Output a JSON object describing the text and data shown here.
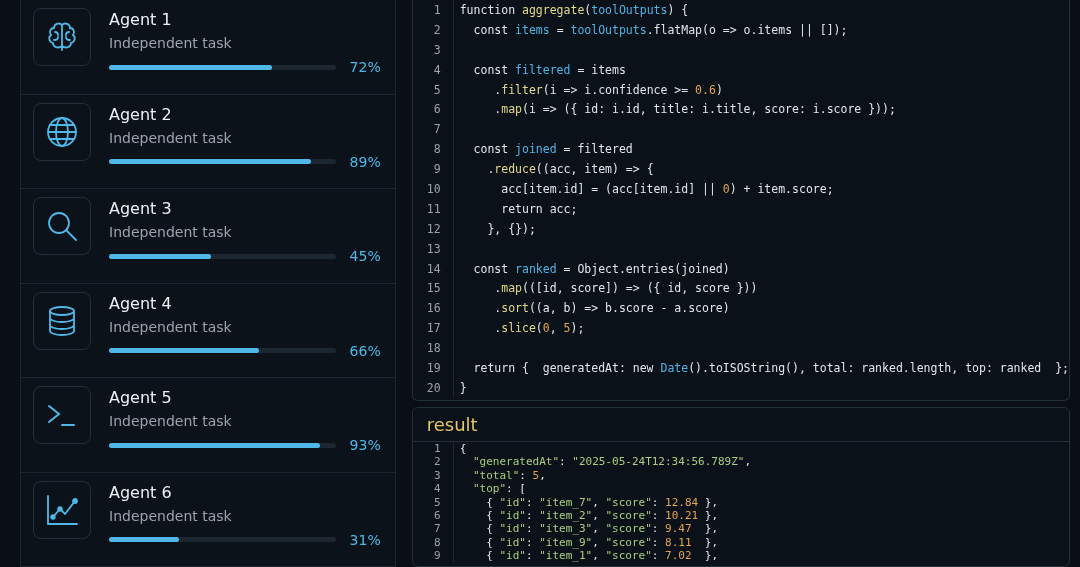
{
  "agents": [
    {
      "name": "Agent 1",
      "task": "Independent task",
      "level": 0.72,
      "percent": "72%"
    },
    {
      "name": "Agent 2",
      "task": "Independent task",
      "level": 0.89,
      "percent": "89%"
    },
    {
      "name": "Agent 3",
      "task": "Independent task",
      "level": 0.45,
      "percent": "45%"
    },
    {
      "name": "Agent 4",
      "task": "Independent task",
      "level": 0.66,
      "percent": "66%"
    },
    {
      "name": "Agent 5",
      "task": "Independent task",
      "level": 0.93,
      "percent": "93%"
    },
    {
      "name": "Agent 6",
      "task": "Independent task",
      "level": 0.31,
      "percent": "31%"
    }
  ],
  "code": {
    "lines": [
      {
        "number": "1",
        "tokens": [
          {
            "text": "function ",
            "kind": "plain"
          },
          {
            "text": "aggregate",
            "kind": "fn"
          },
          {
            "text": "(",
            "kind": "plain"
          },
          {
            "text": "toolOutputs",
            "kind": "var"
          },
          {
            "text": ") {",
            "kind": "plain"
          }
        ]
      },
      {
        "number": "2",
        "tokens": [
          {
            "text": "  const ",
            "kind": "plain"
          },
          {
            "text": "items",
            "kind": "var"
          },
          {
            "text": " = ",
            "kind": "plain"
          },
          {
            "text": "toolOutputs",
            "kind": "var"
          },
          {
            "text": ".flatMap(o => o.items || []);",
            "kind": "plain"
          }
        ]
      },
      {
        "number": "3"
      },
      {
        "number": "4",
        "tokens": [
          {
            "text": "  const ",
            "kind": "plain"
          },
          {
            "text": "filtered",
            "kind": "var"
          },
          {
            "text": " = items",
            "kind": "plain"
          }
        ]
      },
      {
        "number": "5",
        "tokens": [
          {
            "text": "     .",
            "kind": "plain"
          },
          {
            "text": "filter",
            "kind": "fn"
          },
          {
            "text": "(i => i.confidence >= ",
            "kind": "plain"
          },
          {
            "text": "0.6",
            "kind": "num"
          },
          {
            "text": ")",
            "kind": "plain"
          }
        ]
      },
      {
        "number": "6",
        "tokens": [
          {
            "text": "     .",
            "kind": "plain"
          },
          {
            "text": "map",
            "kind": "fn"
          },
          {
            "text": "(i => ({ id: i.id, title: i.title, score: i.score }));",
            "kind": "plain"
          }
        ]
      },
      {
        "number": "7"
      },
      {
        "number": "8",
        "tokens": [
          {
            "text": "  const ",
            "kind": "plain"
          },
          {
            "text": "joined",
            "kind": "var"
          },
          {
            "text": " = filtered",
            "kind": "plain"
          }
        ]
      },
      {
        "number": "9",
        "tokens": [
          {
            "text": "    .",
            "kind": "plain"
          },
          {
            "text": "reduce",
            "kind": "fn"
          },
          {
            "text": "((acc, item) => {",
            "kind": "plain"
          }
        ]
      },
      {
        "number": "10",
        "tokens": [
          {
            "text": "      acc[item.id] = (acc[item.id] || ",
            "kind": "plain"
          },
          {
            "text": "0",
            "kind": "num"
          },
          {
            "text": ") + item.score;",
            "kind": "plain"
          }
        ]
      },
      {
        "number": "11",
        "tokens": [
          {
            "text": "      return acc;",
            "kind": "plain"
          }
        ]
      },
      {
        "number": "12",
        "tokens": [
          {
            "text": "    }, {});",
            "kind": "plain"
          }
        ]
      },
      {
        "number": "13"
      },
      {
        "number": "14",
        "tokens": [
          {
            "text": "  const ",
            "kind": "plain"
          },
          {
            "text": "ranked",
            "kind": "var"
          },
          {
            "text": " = Object.entries(joined)",
            "kind": "plain"
          }
        ]
      },
      {
        "number": "15",
        "tokens": [
          {
            "text": "     .",
            "kind": "plain"
          },
          {
            "text": "map",
            "kind": "fn"
          },
          {
            "text": "(([id, score]) => ({ id, score }))",
            "kind": "plain"
          }
        ]
      },
      {
        "number": "16",
        "tokens": [
          {
            "text": "     .",
            "kind": "plain"
          },
          {
            "text": "sort",
            "kind": "fn"
          },
          {
            "text": "((a, b) => b.score - a.score)",
            "kind": "plain"
          }
        ]
      },
      {
        "number": "17",
        "tokens": [
          {
            "text": "     .",
            "kind": "plain"
          },
          {
            "text": "slice",
            "kind": "fn"
          },
          {
            "text": "(",
            "kind": "plain"
          },
          {
            "text": "0",
            "kind": "num"
          },
          {
            "text": ", ",
            "kind": "plain"
          },
          {
            "text": "5",
            "kind": "num"
          },
          {
            "text": ");",
            "kind": "plain"
          }
        ]
      },
      {
        "number": "18"
      },
      {
        "number": "19",
        "tokens": [
          {
            "text": "  return {  generatedAt: new ",
            "kind": "plain"
          },
          {
            "text": "Date",
            "kind": "var"
          },
          {
            "text": "().toISOString(), total: ranked.length, top: ranked  };",
            "kind": "plain"
          }
        ]
      },
      {
        "number": "20",
        "tokens": [
          {
            "text": "}",
            "kind": "plain"
          }
        ]
      }
    ]
  },
  "result": {
    "title": "result",
    "lines": [
      {
        "number": "1",
        "tokens": [
          {
            "text": "{",
            "kind": "plain"
          }
        ]
      },
      {
        "number": "2",
        "tokens": [
          {
            "text": "  \"generatedAt\"",
            "kind": "str"
          },
          {
            "text": ": ",
            "kind": "plain"
          },
          {
            "text": "\"2025-05-24T12:34:56.789Z\"",
            "kind": "str"
          },
          {
            "text": ",",
            "kind": "plain"
          }
        ]
      },
      {
        "number": "3",
        "tokens": [
          {
            "text": "  \"total\"",
            "kind": "str"
          },
          {
            "text": ": ",
            "kind": "plain"
          },
          {
            "text": "5",
            "kind": "num"
          },
          {
            "text": ",",
            "kind": "plain"
          }
        ]
      },
      {
        "number": "4",
        "tokens": [
          {
            "text": "  \"top\"",
            "kind": "str"
          },
          {
            "text": ": [",
            "kind": "plain"
          }
        ]
      },
      {
        "number": "5",
        "tokens": [
          {
            "text": "    { ",
            "kind": "plain"
          },
          {
            "text": "\"id\"",
            "kind": "str"
          },
          {
            "text": ": ",
            "kind": "plain"
          },
          {
            "text": "\"item_7\"",
            "kind": "str"
          },
          {
            "text": ", ",
            "kind": "plain"
          },
          {
            "text": "\"score\"",
            "kind": "str"
          },
          {
            "text": ": ",
            "kind": "plain"
          },
          {
            "text": "12.84",
            "kind": "num"
          },
          {
            "text": " },",
            "kind": "plain"
          }
        ]
      },
      {
        "number": "6",
        "tokens": [
          {
            "text": "    { ",
            "kind": "plain"
          },
          {
            "text": "\"id\"",
            "kind": "str"
          },
          {
            "text": ": ",
            "kind": "plain"
          },
          {
            "text": "\"item_2\"",
            "kind": "str"
          },
          {
            "text": ", ",
            "kind": "plain"
          },
          {
            "text": "\"score\"",
            "kind": "str"
          },
          {
            "text": ": ",
            "kind": "plain"
          },
          {
            "text": "10.21",
            "kind": "num"
          },
          {
            "text": " },",
            "kind": "plain"
          }
        ]
      },
      {
        "number": "7",
        "tokens": [
          {
            "text": "    { ",
            "kind": "plain"
          },
          {
            "text": "\"id\"",
            "kind": "str"
          },
          {
            "text": ": ",
            "kind": "plain"
          },
          {
            "text": "\"item_3\"",
            "kind": "str"
          },
          {
            "text": ", ",
            "kind": "plain"
          },
          {
            "text": "\"score\"",
            "kind": "str"
          },
          {
            "text": ": ",
            "kind": "plain"
          },
          {
            "text": "9.47",
            "kind": "num"
          },
          {
            "text": "  },",
            "kind": "plain"
          }
        ]
      },
      {
        "number": "8",
        "tokens": [
          {
            "text": "    { ",
            "kind": "plain"
          },
          {
            "text": "\"id\"",
            "kind": "str"
          },
          {
            "text": ": ",
            "kind": "plain"
          },
          {
            "text": "\"item_9\"",
            "kind": "str"
          },
          {
            "text": ", ",
            "kind": "plain"
          },
          {
            "text": "\"score\"",
            "kind": "str"
          },
          {
            "text": ": ",
            "kind": "plain"
          },
          {
            "text": "8.11",
            "kind": "num"
          },
          {
            "text": "  },",
            "kind": "plain"
          }
        ]
      },
      {
        "number": "9",
        "tokens": [
          {
            "text": "    { ",
            "kind": "plain"
          },
          {
            "text": "\"id\"",
            "kind": "str"
          },
          {
            "text": ": ",
            "kind": "plain"
          },
          {
            "text": "\"item_1\"",
            "kind": "str"
          },
          {
            "text": ", ",
            "kind": "plain"
          },
          {
            "text": "\"score\"",
            "kind": "str"
          },
          {
            "text": ": ",
            "kind": "plain"
          },
          {
            "text": "7.02",
            "kind": "num"
          },
          {
            "text": "  },",
            "kind": "plain"
          }
        ]
      }
    ]
  }
}
